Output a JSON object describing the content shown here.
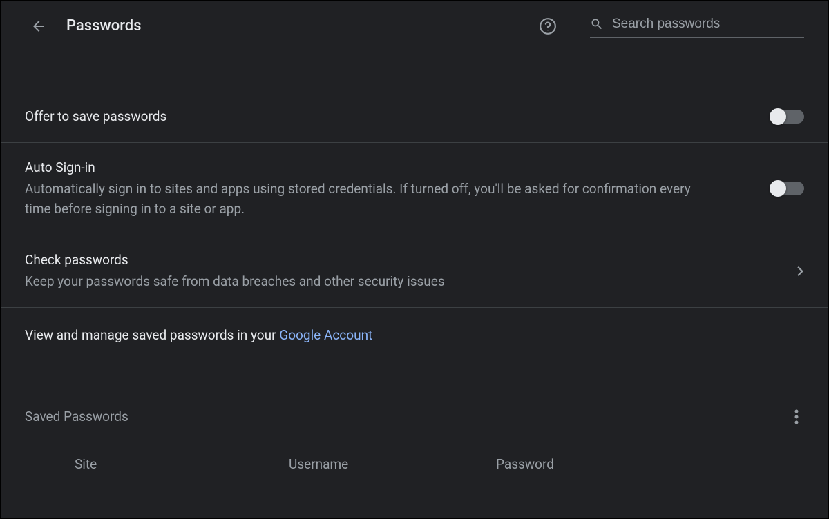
{
  "header": {
    "title": "Passwords",
    "search_placeholder": "Search passwords"
  },
  "settings": {
    "offer_save": {
      "title": "Offer to save passwords"
    },
    "auto_signin": {
      "title": "Auto Sign-in",
      "desc": "Automatically sign in to sites and apps using stored credentials. If turned off, you'll be asked for confirmation every time before signing in to a site or app."
    },
    "check_passwords": {
      "title": "Check passwords",
      "desc": "Keep your passwords safe from data breaches and other security issues"
    }
  },
  "manage": {
    "prefix": "View and manage saved passwords in your ",
    "link": "Google Account"
  },
  "saved": {
    "section_title": "Saved Passwords",
    "columns": {
      "site": "Site",
      "username": "Username",
      "password": "Password"
    }
  }
}
